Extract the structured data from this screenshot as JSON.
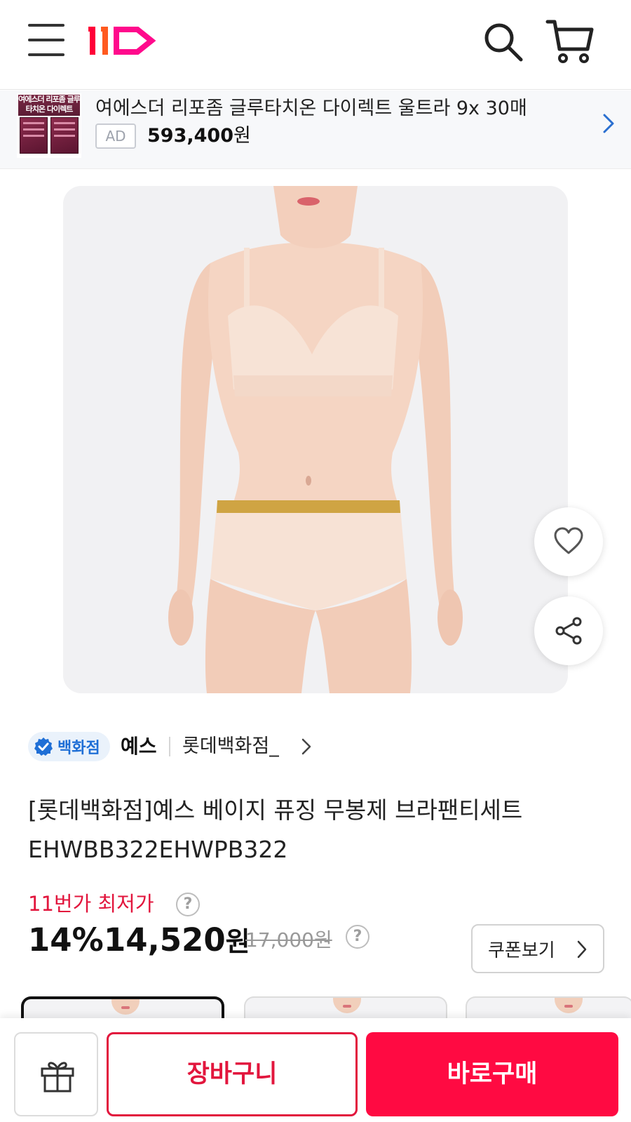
{
  "header": {
    "logo_text": "11",
    "brand_color": "#ff0038"
  },
  "ad": {
    "thumb_text": "여에스더 리포좀 글루타치온 다이렉트",
    "title": "여에스더 리포좀 글루타치온 다이렉트 울트라 9x 30매",
    "badge": "AD",
    "price": "593,400",
    "price_unit": "원"
  },
  "store": {
    "badge_label": "백화점",
    "brand": "예스",
    "store_name": "롯데백화점_"
  },
  "product": {
    "title": "[롯데백화점]예스 베이지 퓨징 무봉제 브라팬티세트 EHWBB322EHWPB322",
    "price_label": "11번가 최저가",
    "help_mark": "?",
    "discount": "14%",
    "sale_price": "14,520",
    "sale_unit": "원",
    "original_price": "17,000원",
    "coupon_label": "쿠폰보기"
  },
  "bottom_bar": {
    "cart_label": "장바구니",
    "buy_label": "바로구매"
  },
  "colors": {
    "accent": "#e2163d",
    "buy_button": "#ff0a42",
    "verified_blue": "#1f6fd6"
  }
}
